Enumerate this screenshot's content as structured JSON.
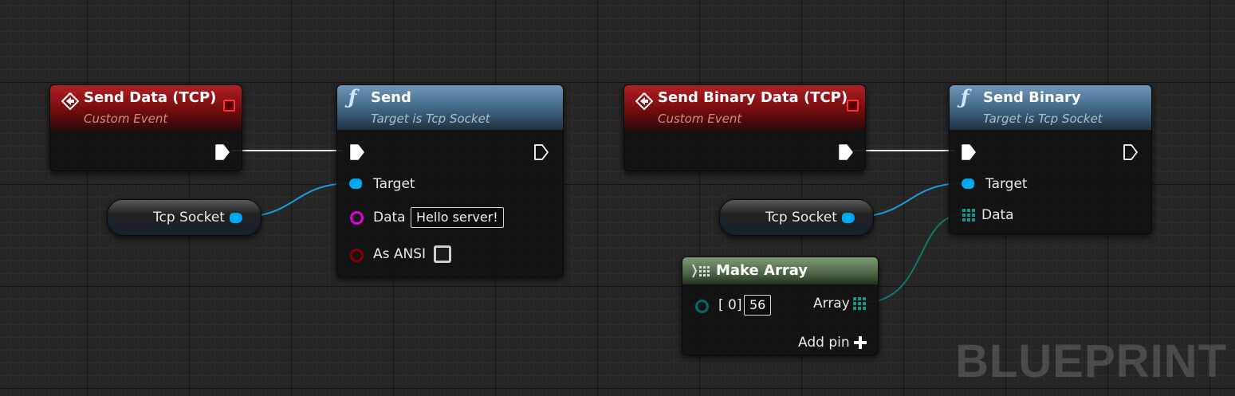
{
  "nodes": {
    "send_data_event": {
      "title": "Send Data (TCP)",
      "subtitle": "Custom Event"
    },
    "send_function": {
      "title": "Send",
      "subtitle": "Target is Tcp Socket",
      "target_label": "Target",
      "data_label": "Data",
      "data_value": "Hello server!",
      "ansi_label": "As ANSI",
      "ansi_checked": false
    },
    "tcp_socket_var_1": {
      "label": "Tcp Socket"
    },
    "send_binary_event": {
      "title": "Send Binary Data (TCP)",
      "subtitle": "Custom Event"
    },
    "send_binary_function": {
      "title": "Send Binary",
      "subtitle": "Target is Tcp Socket",
      "target_label": "Target",
      "data_label": "Data"
    },
    "tcp_socket_var_2": {
      "label": "Tcp Socket"
    },
    "make_array": {
      "title": "Make Array",
      "index_label": "[ 0]",
      "index_value": "56",
      "array_label": "Array",
      "add_pin_label": "Add pin"
    }
  },
  "watermark": "BLUEPRINT",
  "colors": {
    "exec": "#ffffff",
    "object_pin": "#00a8f4",
    "string_pin": "#e000e0",
    "bool_pin": "#8c0000",
    "byte_pin": "#006e64",
    "event_header": "#a4161a",
    "function_header": "#557b9e",
    "pure_header": "#6a8a5e"
  }
}
